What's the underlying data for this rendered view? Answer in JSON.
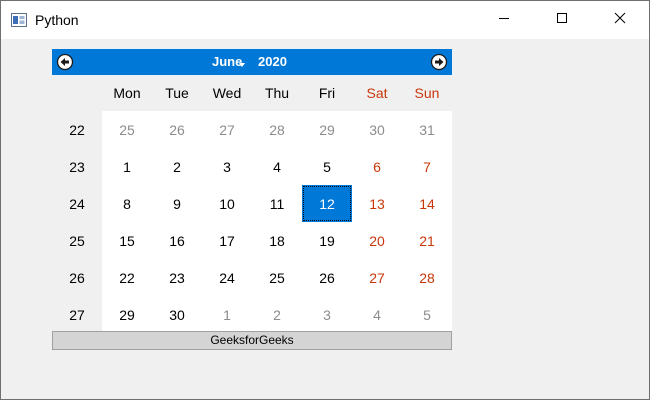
{
  "window": {
    "title": "Python",
    "icon": "python-window-icon",
    "controls": [
      "minimize-icon",
      "maximize-icon",
      "close-icon"
    ]
  },
  "calendar": {
    "month": "June",
    "year": "2020",
    "selected_date": "12",
    "colors": {
      "accent": "#0078d7",
      "weekend": "#c8370a",
      "dimmed": "#8c8c8c"
    },
    "nav": {
      "prev_icon": "left-arrow-circle-icon",
      "next_icon": "right-arrow-circle-icon"
    },
    "weekdays": [
      "Mon",
      "Tue",
      "Wed",
      "Thu",
      "Fri",
      "Sat",
      "Sun"
    ],
    "weeks": [
      {
        "num": "22",
        "days": [
          "25",
          "26",
          "27",
          "28",
          "29",
          "30",
          "31"
        ],
        "dim": [
          true,
          true,
          true,
          true,
          true,
          true,
          true
        ]
      },
      {
        "num": "23",
        "days": [
          "1",
          "2",
          "3",
          "4",
          "5",
          "6",
          "7"
        ],
        "dim": [
          false,
          false,
          false,
          false,
          false,
          false,
          false
        ]
      },
      {
        "num": "24",
        "days": [
          "8",
          "9",
          "10",
          "11",
          "12",
          "13",
          "14"
        ],
        "dim": [
          false,
          false,
          false,
          false,
          false,
          false,
          false
        ]
      },
      {
        "num": "25",
        "days": [
          "15",
          "16",
          "17",
          "18",
          "19",
          "20",
          "21"
        ],
        "dim": [
          false,
          false,
          false,
          false,
          false,
          false,
          false
        ]
      },
      {
        "num": "26",
        "days": [
          "22",
          "23",
          "24",
          "25",
          "26",
          "27",
          "28"
        ],
        "dim": [
          false,
          false,
          false,
          false,
          false,
          false,
          false
        ]
      },
      {
        "num": "27",
        "days": [
          "29",
          "30",
          "1",
          "2",
          "3",
          "4",
          "5"
        ],
        "dim": [
          false,
          false,
          true,
          true,
          true,
          true,
          true
        ]
      }
    ]
  },
  "status_label": "GeeksforGeeks"
}
